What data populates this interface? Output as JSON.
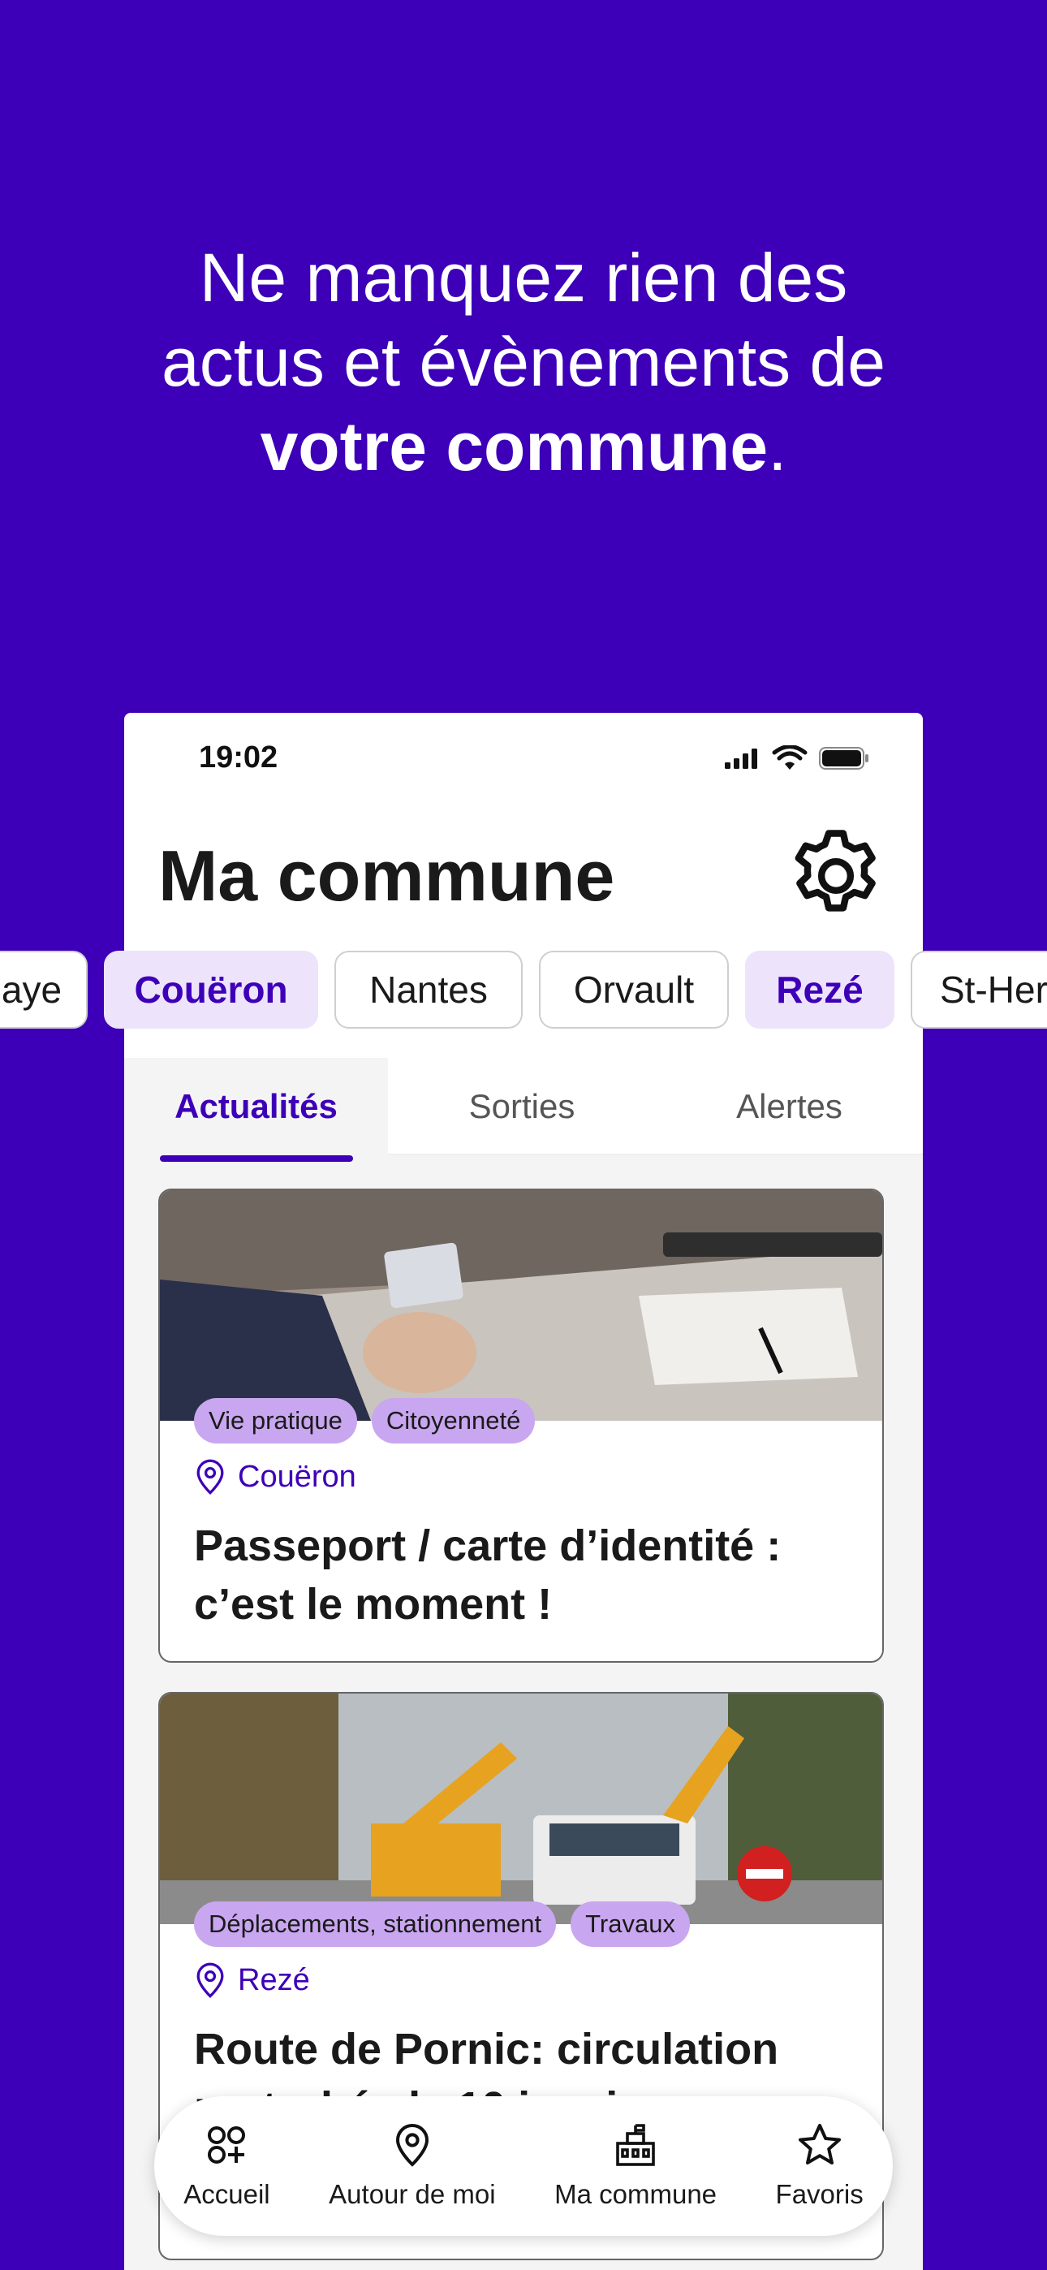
{
  "colors": {
    "brand": "#3D00B8",
    "tag_bg": "#C9A6F0",
    "chip_selected_bg": "#EDE3FB"
  },
  "headline": {
    "line1": "Ne manquez rien des",
    "line2": "actus et évènements de",
    "line3_strong": "votre commune",
    "line3_end": "."
  },
  "status_bar": {
    "time": "19:02"
  },
  "header": {
    "title": "Ma commune"
  },
  "communes": [
    {
      "label": "aye",
      "selected": false
    },
    {
      "label": "Couëron",
      "selected": true
    },
    {
      "label": "Nantes",
      "selected": false
    },
    {
      "label": "Orvault",
      "selected": false
    },
    {
      "label": "Rezé",
      "selected": true
    },
    {
      "label": "St-Her",
      "selected": false
    }
  ],
  "tabs": [
    {
      "label": "Actualités",
      "active": true
    },
    {
      "label": "Sorties",
      "active": false
    },
    {
      "label": "Alertes",
      "active": false
    }
  ],
  "articles": [
    {
      "tags": [
        "Vie pratique",
        "Citoyenneté"
      ],
      "location": "Couëron",
      "title": "Passeport / carte d’identité : c’est le moment !"
    },
    {
      "tags": [
        "Déplacements, stationnement",
        "Travaux"
      ],
      "location": "Rezé",
      "title": "Route de Pornic: circulation perturbée le 10 janvier"
    }
  ],
  "bottom_nav": [
    {
      "label": "Accueil",
      "icon": "home-grid-icon"
    },
    {
      "label": "Autour de moi",
      "icon": "location-pin-icon"
    },
    {
      "label": "Ma commune",
      "icon": "city-hall-icon"
    },
    {
      "label": "Favoris",
      "icon": "star-icon"
    }
  ]
}
